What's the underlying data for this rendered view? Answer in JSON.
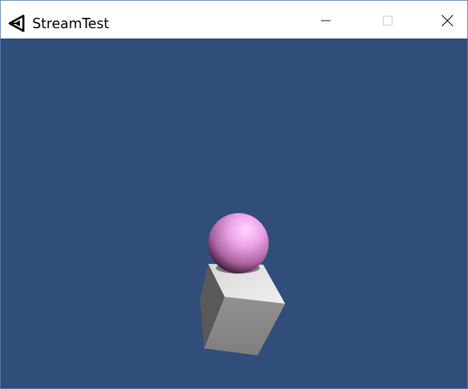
{
  "window": {
    "title": "StreamTest",
    "app_icon": "unity-icon",
    "controls": {
      "minimize_icon": "minimize-icon",
      "maximize_icon": "maximize-icon",
      "close_icon": "close-icon"
    }
  },
  "viewport": {
    "background_color": "#314d79",
    "objects": [
      {
        "name": "sphere",
        "color": "#f2a6f0"
      },
      {
        "name": "cube",
        "color": "#8c8c8c"
      }
    ]
  }
}
